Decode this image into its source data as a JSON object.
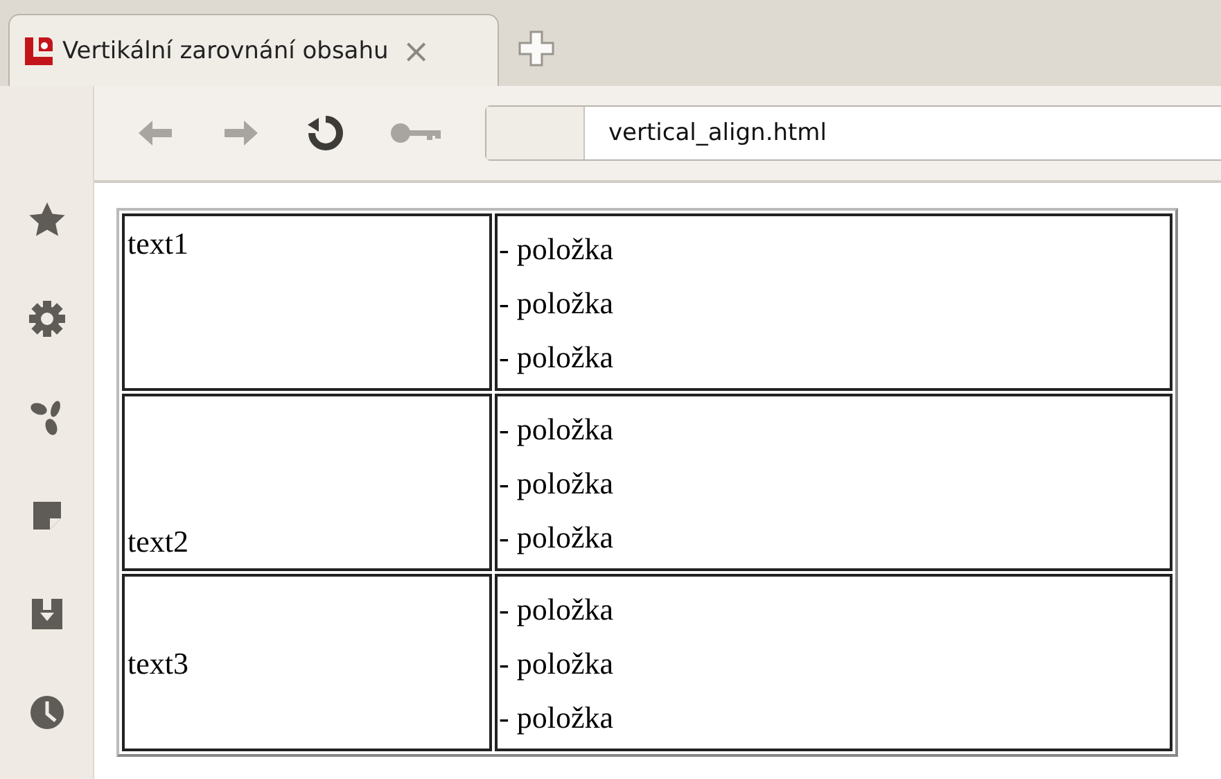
{
  "tabs": [
    {
      "title": "Vertikální zarovnání obsahu",
      "close": "×",
      "selected": true
    }
  ],
  "address_bar": {
    "url": "vertical_align.html"
  },
  "table": {
    "rows": [
      {
        "label": "text1",
        "kind": "top",
        "items": [
          "- položka",
          "- položka",
          "- položka"
        ]
      },
      {
        "label": "text2",
        "kind": "bottom",
        "items": [
          "- položka",
          "- položka",
          "- položka"
        ]
      },
      {
        "label": "text3",
        "kind": "middle",
        "items": [
          "- položka",
          "- položka",
          "- položka"
        ]
      }
    ]
  }
}
